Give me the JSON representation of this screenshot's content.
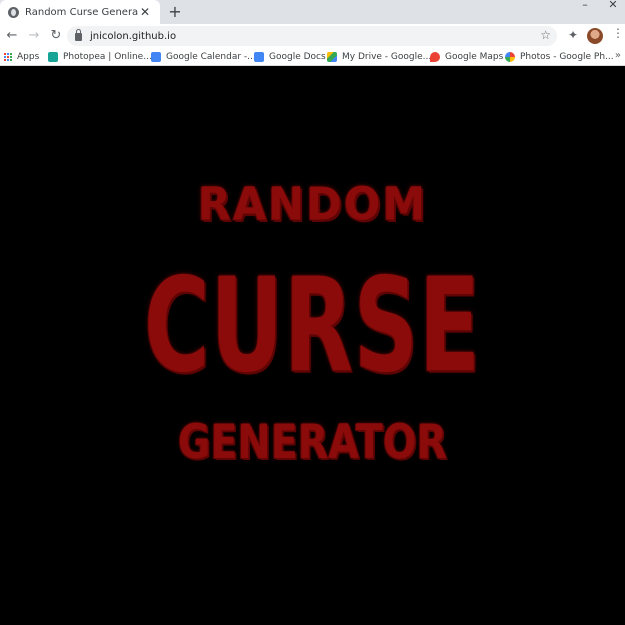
{
  "browser": {
    "tab_title": "Random Curse Generator",
    "tab_close": "✕",
    "new_tab": "+",
    "minimize": "–",
    "close_window": "✕",
    "back": "←",
    "forward": "→",
    "reload": "↻",
    "url": "jnicolon.github.io",
    "star": "☆",
    "extensions": "✦",
    "menu": "⋮",
    "bookmarks": [
      {
        "label": "Apps",
        "icon": "apps-grid-icon"
      },
      {
        "label": "Photopea | Online...",
        "icon": "photopea-icon",
        "color": "#18a497"
      },
      {
        "label": "Google Calendar -...",
        "icon": "calendar-icon",
        "color": "#4285f4"
      },
      {
        "label": "Google Docs",
        "icon": "docs-icon",
        "color": "#4285f4"
      },
      {
        "label": "My Drive - Google...",
        "icon": "drive-icon",
        "color": "#fbbc04"
      },
      {
        "label": "Google Maps",
        "icon": "maps-icon",
        "color": "#ea4335"
      },
      {
        "label": "Photos - Google Ph...",
        "icon": "photos-icon",
        "color": "#34a853"
      }
    ],
    "bookmarks_overflow": "»"
  },
  "page": {
    "line1": "RANDOM",
    "line2": "CURSE",
    "line3": "GENERATOR",
    "text_color": "#8b0b0b",
    "background": "#000000"
  }
}
